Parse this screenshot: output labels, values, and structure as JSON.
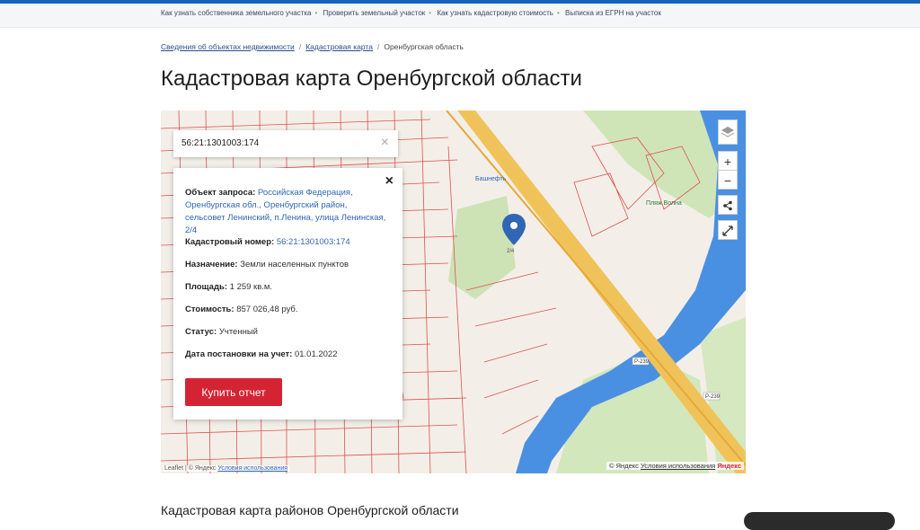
{
  "subnav": {
    "links": [
      "Как узнать собственника земельного участка",
      "Проверить земельный участок",
      "Как узнать кадастровую стоимость",
      "Выписка из ЕГРН на участок"
    ]
  },
  "breadcrumb": {
    "items": [
      "Сведения об объектах недвижимости",
      "Кадастровая карта",
      "Оренбургская область"
    ]
  },
  "page": {
    "title": "Кадастровая карта Оренбургской области"
  },
  "search": {
    "value": "56:21:1301003:174",
    "clear": "×"
  },
  "info": {
    "close": "×",
    "request_label": "Объект запроса:",
    "request_value": "Российская Федерация, Оренбургская обл., Оренбургский район, сельсовет Ленинский, п.Ленина, улица Ленинская, 2/4",
    "cadastral_label": "Кадастровый номер:",
    "cadastral_value": "56:21:1301003:174",
    "purpose_label": "Назначение:",
    "purpose_value": "Земли населенных пунктов",
    "area_label": "Площадь:",
    "area_value": "1 259 кв.м.",
    "cost_label": "Стоимость:",
    "cost_value": "857 026,48 руб.",
    "status_label": "Статус:",
    "status_value": "Учтенный",
    "date_label": "Дата постановки на учет:",
    "date_value": "01.01.2022",
    "buy_label": "Купить отчет"
  },
  "map_controls": {
    "zoom_in": "+",
    "zoom_out": "−"
  },
  "map_labels": {
    "bashneft": "Башнефть",
    "plazh": "Пляж Волна",
    "road": "Р-239",
    "road2": "Р-239",
    "pin_num": "2/4"
  },
  "attribution": {
    "leaflet": "Leaflet",
    "yandex_left": "| © Яндекс",
    "terms_left": "Условия использования",
    "yandex_right": "© Яндекс",
    "terms_right": "Условия использования",
    "logo": "Яндекс"
  },
  "section": {
    "heading": "Кадастровая карта районов Оренбургской области"
  },
  "colors": {
    "accent": "#d42434",
    "brand_blue": "#1565c0",
    "water": "#4a90e2",
    "parcel": "#e05050"
  }
}
